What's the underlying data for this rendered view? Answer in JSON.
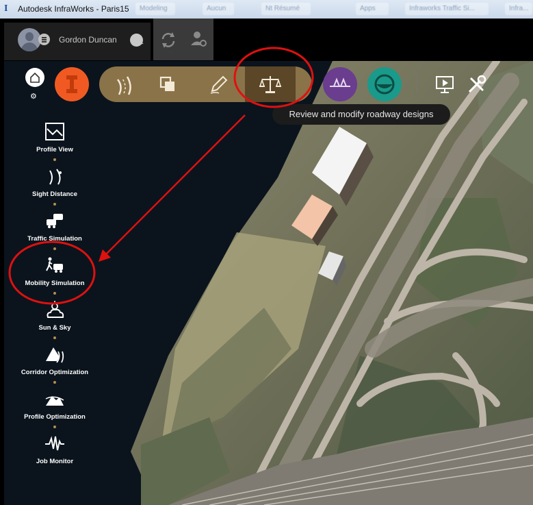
{
  "window": {
    "title": "Autodesk InfraWorks - Paris15",
    "bg_tabs": [
      "Modeling",
      "Aucun",
      "Nt Résumé",
      "Apps",
      "Infraworks Traffic Si...",
      "Infra..."
    ]
  },
  "header": {
    "user_name": "Gordon Duncan",
    "icons": [
      "avatar",
      "menu-icon",
      "chat-icon",
      "sync-icon",
      "account-settings-icon"
    ]
  },
  "toolbar": {
    "tools": [
      "roadway-icon",
      "layers-icon",
      "sketch-pencil-icon",
      "analyze-balance-icon"
    ],
    "active_tool": "analyze-balance-icon",
    "extra_tools": [
      "bridge-icon",
      "drainage-icon",
      "presentation-icon",
      "settings-tools-icon"
    ],
    "tooltip": "Review and modify roadway designs"
  },
  "sidebar": {
    "items": [
      {
        "label": "Profile View",
        "icon": "profile-view-icon"
      },
      {
        "label": "Sight Distance",
        "icon": "sight-distance-icon"
      },
      {
        "label": "Traffic Simulation",
        "icon": "traffic-simulation-icon"
      },
      {
        "label": "Mobility Simulation",
        "icon": "mobility-simulation-icon"
      },
      {
        "label": "Sun & Sky",
        "icon": "sun-sky-icon"
      },
      {
        "label": "Corridor Optimization",
        "icon": "corridor-optimization-icon"
      },
      {
        "label": "Profile Optimization",
        "icon": "profile-optimization-icon"
      },
      {
        "label": "Job Monitor",
        "icon": "job-monitor-icon"
      }
    ]
  },
  "colors": {
    "toolbar_pill": "#8a7348",
    "toolbar_active": "#5b4628",
    "infraworks_orange": "#f05a22",
    "bridge_purple": "#6a3d8f",
    "drainage_teal": "#1a9a8a",
    "annotation_red": "#e01010",
    "sidebar_dot": "#b58d4f"
  }
}
